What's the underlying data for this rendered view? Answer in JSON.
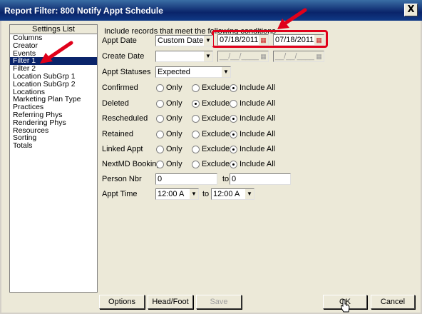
{
  "window": {
    "title": "Report Filter: 800 Notify Appt Schedule",
    "close_glyph": "X"
  },
  "settings": {
    "header": "Settings List",
    "items": [
      "Columns",
      "Creator",
      "Events",
      "Filter 1",
      "Filter 2",
      "Location SubGrp 1",
      "Location SubGrp 2",
      "Locations",
      "Marketing Plan Type",
      "Practices",
      "Referring Phys",
      "Rendering Phys",
      "Resources",
      "Sorting",
      "Totals"
    ],
    "selected": "Filter 1"
  },
  "filter": {
    "intro": "Include records that meet the following conditions",
    "appt_date": {
      "label": "Appt Date",
      "mode": "Custom Date",
      "from": "07/18/2011",
      "to": "07/18/2011"
    },
    "create_date": {
      "label": "Create Date",
      "mode": "",
      "from": "__/__/____",
      "to": "__/__/____"
    },
    "appt_statuses": {
      "label": "Appt Statuses",
      "value": "Expected"
    },
    "options": {
      "only": "Only",
      "exclude": "Exclude",
      "include_all": "Include All"
    },
    "radio_rows": [
      {
        "label": "Confirmed",
        "selected": "include_all"
      },
      {
        "label": "Deleted",
        "selected": "exclude"
      },
      {
        "label": "Rescheduled",
        "selected": "include_all"
      },
      {
        "label": "Retained",
        "selected": "include_all"
      },
      {
        "label": "Linked Appt",
        "selected": "include_all"
      },
      {
        "label": "NextMD Booking",
        "selected": "include_all"
      }
    ],
    "person_nbr": {
      "label": "Person Nbr",
      "from": "0",
      "to_label": "to",
      "to": "0"
    },
    "appt_time": {
      "label": "Appt Time",
      "from": "12:00 A",
      "to_label": "to",
      "to": "12:00 A"
    }
  },
  "buttons": {
    "options": "Options",
    "head_foot": "Head/Foot",
    "save": "Save",
    "ok": "OK",
    "cancel": "Cancel"
  },
  "colors": {
    "title_bar": "#0a246a",
    "highlight": "#e0001a",
    "selection": "#0a246a"
  },
  "icons": {
    "calendar": "calendar-icon",
    "dropdown": "chevron-down-icon",
    "arrow": "red-arrow"
  }
}
